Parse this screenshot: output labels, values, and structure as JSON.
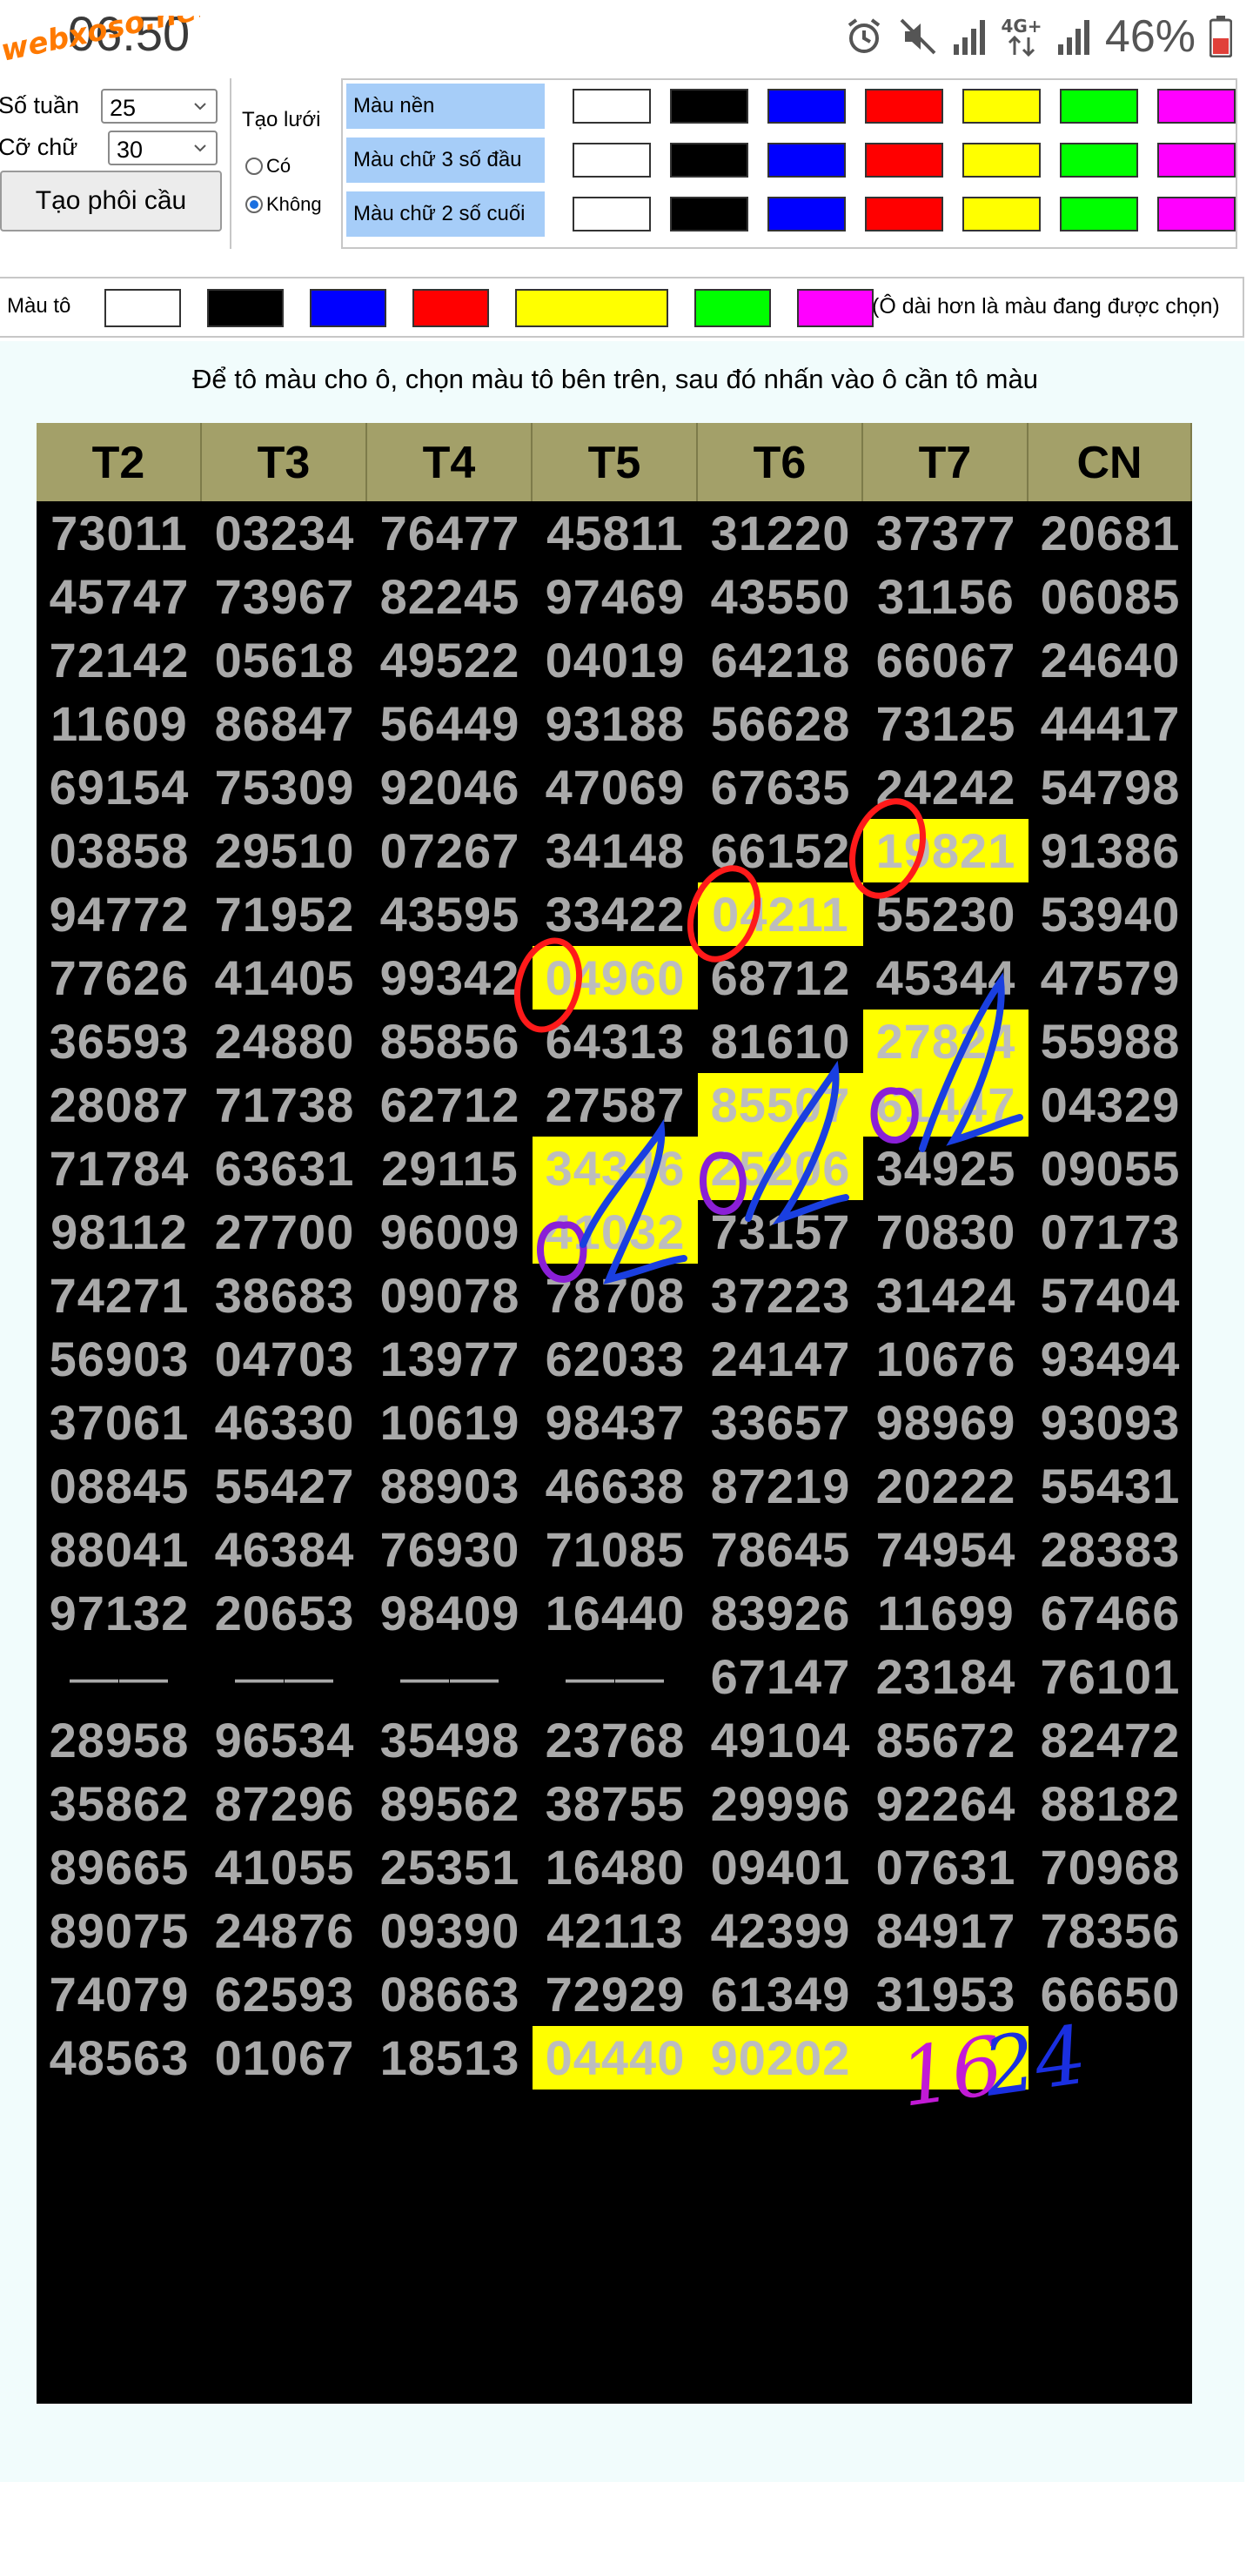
{
  "status": {
    "time": "06:50",
    "watermark": "webxoso.net",
    "network": "4G+",
    "battery": "46%"
  },
  "controls": {
    "weeks_label": "Số tuần",
    "weeks_value": "25",
    "font_label": "Cỡ chữ",
    "font_value": "30",
    "create_button": "Tạo phôi cầu",
    "grid_title": "Tạo lưới",
    "grid_yes": "Có",
    "grid_no": "Không",
    "grid_selected": "Không",
    "rows": [
      {
        "label": "Màu nền"
      },
      {
        "label": "Màu chữ 3 số đầu"
      },
      {
        "label": "Màu chữ 2 số cuối"
      }
    ],
    "palette": [
      "#ffffff",
      "#000000",
      "#0000ff",
      "#ff0000",
      "#ffff00",
      "#00ff00",
      "#ff00ff"
    ],
    "paint_label": "Màu tô",
    "paint_selected": "#ffff00",
    "paint_note": "(Ô dài hơn là màu đang được chọn)"
  },
  "instruction": "Để tô màu cho ô, chọn màu tô bên trên, sau đó nhấn vào ô cần tô màu",
  "board": {
    "days": [
      "T2",
      "T3",
      "T4",
      "T5",
      "T6",
      "T7",
      "CN"
    ],
    "rows": [
      [
        "73011",
        "03234",
        "76477",
        "45811",
        "31220",
        "37377",
        "20681"
      ],
      [
        "45747",
        "73967",
        "82245",
        "97469",
        "43550",
        "31156",
        "06085"
      ],
      [
        "72142",
        "05618",
        "49522",
        "04019",
        "64218",
        "66067",
        "24640"
      ],
      [
        "11609",
        "86847",
        "56449",
        "93188",
        "56628",
        "73125",
        "44417"
      ],
      [
        "69154",
        "75309",
        "92046",
        "47069",
        "67635",
        "24242",
        "54798"
      ],
      [
        "03858",
        "29510",
        "07267",
        "34148",
        "66152",
        "19821",
        "91386"
      ],
      [
        "94772",
        "71952",
        "43595",
        "33422",
        "04211",
        "55230",
        "53940"
      ],
      [
        "77626",
        "41405",
        "99342",
        "04960",
        "68712",
        "45344",
        "47579"
      ],
      [
        "36593",
        "24880",
        "85856",
        "64313",
        "81610",
        "27824",
        "55988"
      ],
      [
        "28087",
        "71738",
        "62712",
        "27587",
        "85507",
        "61447",
        "04329"
      ],
      [
        "71784",
        "63631",
        "29115",
        "34346",
        "25206",
        "34925",
        "09055"
      ],
      [
        "98112",
        "27700",
        "96009",
        "41032",
        "73157",
        "70830",
        "07173"
      ],
      [
        "74271",
        "38683",
        "09078",
        "78708",
        "37223",
        "31424",
        "57404"
      ],
      [
        "56903",
        "04703",
        "13977",
        "62033",
        "24147",
        "10676",
        "93494"
      ],
      [
        "37061",
        "46330",
        "10619",
        "98437",
        "33657",
        "98969",
        "93093"
      ],
      [
        "08845",
        "55427",
        "88903",
        "46638",
        "87219",
        "20222",
        "55431"
      ],
      [
        "88041",
        "46384",
        "76930",
        "71085",
        "78645",
        "74954",
        "28383"
      ],
      [
        "97132",
        "20653",
        "98409",
        "16440",
        "83926",
        "11699",
        "67466"
      ],
      [
        "——",
        "——",
        "——",
        "——",
        "67147",
        "23184",
        "76101"
      ],
      [
        "28958",
        "96534",
        "35498",
        "23768",
        "49104",
        "85672",
        "82472"
      ],
      [
        "35862",
        "87296",
        "89562",
        "38755",
        "29996",
        "92264",
        "88182"
      ],
      [
        "89665",
        "41055",
        "25351",
        "16480",
        "09401",
        "07631",
        "70968"
      ],
      [
        "89075",
        "24876",
        "09390",
        "42113",
        "42399",
        "84917",
        "78356"
      ],
      [
        "74079",
        "62593",
        "08663",
        "72929",
        "61349",
        "31953",
        "66650"
      ],
      [
        "48563",
        "01067",
        "18513",
        "04440",
        "90202",
        "",
        ""
      ]
    ],
    "highlighted": [
      [
        5,
        5
      ],
      [
        6,
        4
      ],
      [
        7,
        3
      ],
      [
        8,
        5
      ],
      [
        9,
        4
      ],
      [
        9,
        5
      ],
      [
        10,
        3
      ],
      [
        10,
        4
      ],
      [
        11,
        3
      ],
      [
        24,
        3
      ],
      [
        24,
        4
      ],
      [
        24,
        5
      ]
    ]
  },
  "handwriting": {
    "note_left": "16",
    "note_right": "24"
  }
}
